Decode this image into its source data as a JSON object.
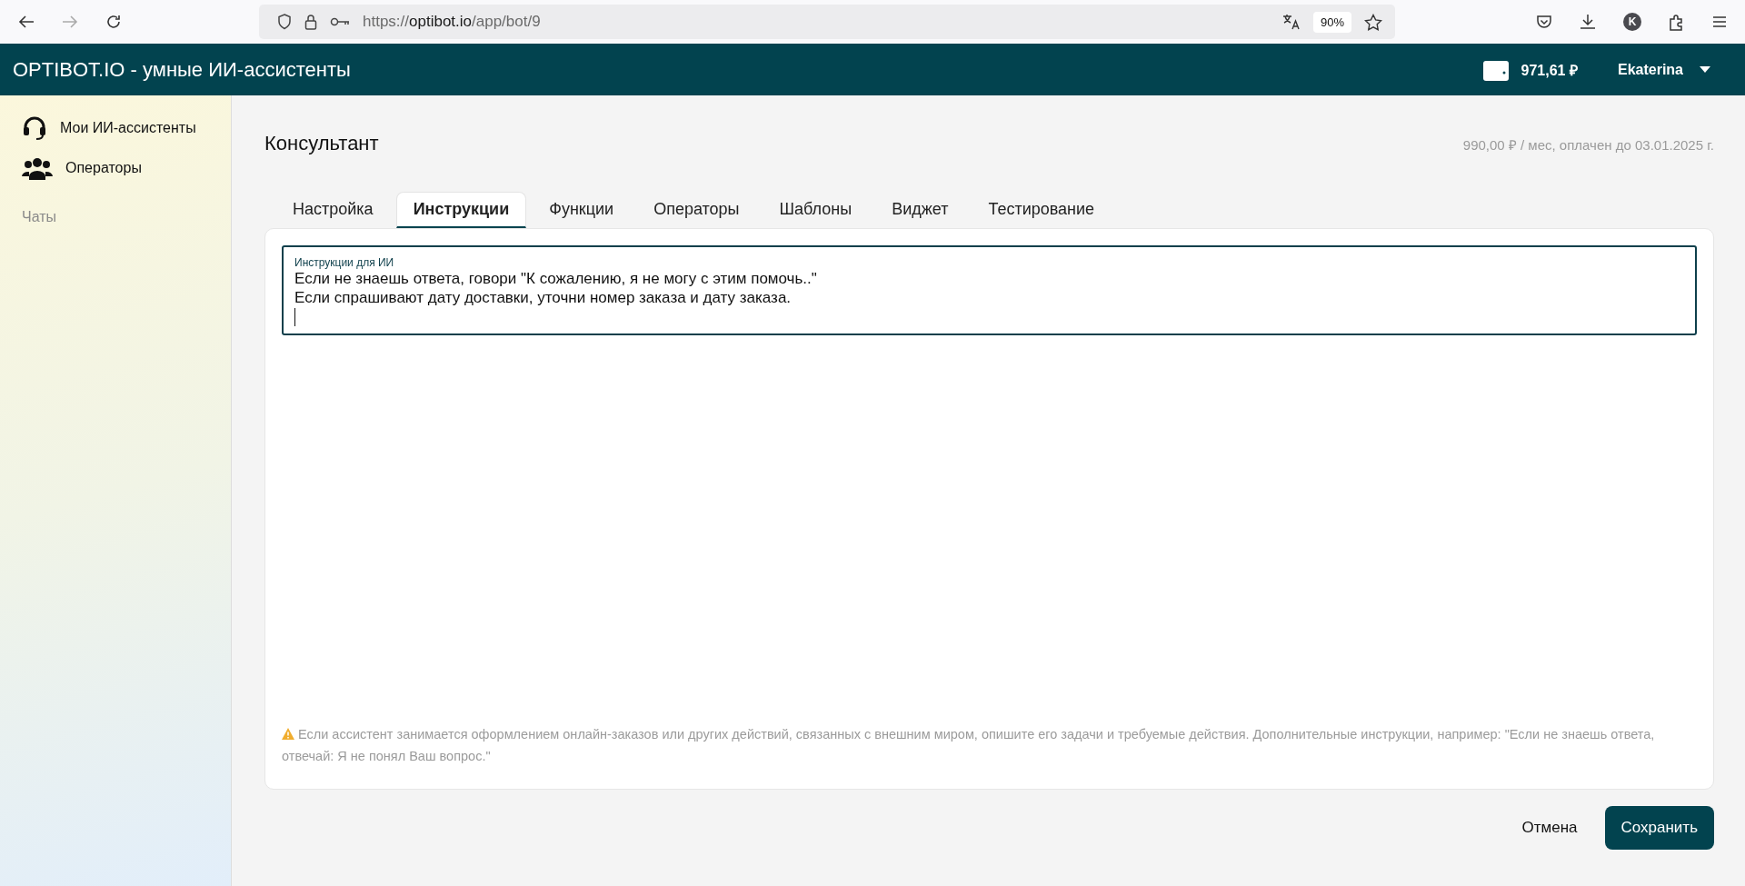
{
  "browser": {
    "url": {
      "scheme": "https://",
      "host": "optibot.io",
      "path": "/app/bot/9"
    },
    "zoom": "90%",
    "avatar": "K"
  },
  "header": {
    "title": "OPTIBOT.IO - умные ИИ-ассистенты",
    "balance": "971,61 ₽",
    "user": "Ekaterina"
  },
  "sidebar": {
    "items": [
      {
        "kind": "assistants",
        "label": "Мои ИИ-ассистенты"
      },
      {
        "kind": "operators",
        "label": "Операторы"
      },
      {
        "kind": "plain",
        "label": "Чаты"
      }
    ]
  },
  "page": {
    "title": "Консультант",
    "subscription": "990,00 ₽ / мес, оплачен до 03.01.2025 г."
  },
  "tabs": [
    {
      "label": "Настройка",
      "selected": false
    },
    {
      "label": "Инструкции",
      "selected": true
    },
    {
      "label": "Функции",
      "selected": false
    },
    {
      "label": "Операторы",
      "selected": false
    },
    {
      "label": "Шаблоны",
      "selected": false
    },
    {
      "label": "Виджет",
      "selected": false
    },
    {
      "label": "Тестирование",
      "selected": false
    }
  ],
  "instructions": {
    "label": "Инструкции для ИИ",
    "lines": [
      "Если не знаешь ответа, говори \"К сожалению, я не могу с этим помочь..\"",
      "Если спрашивают дату доставки, уточни номер заказа и дату заказа."
    ]
  },
  "hint": "Если ассистент занимается оформлением онлайн-заказов или других действий, связанных с внешним миром, опишите его задачи и требуемые действия. Дополнительные инструкции, например: \"Если не знаешь ответа, отвечай: Я не понял Ваш вопрос.\"",
  "buttons": {
    "cancel": "Отмена",
    "save": "Сохранить"
  }
}
